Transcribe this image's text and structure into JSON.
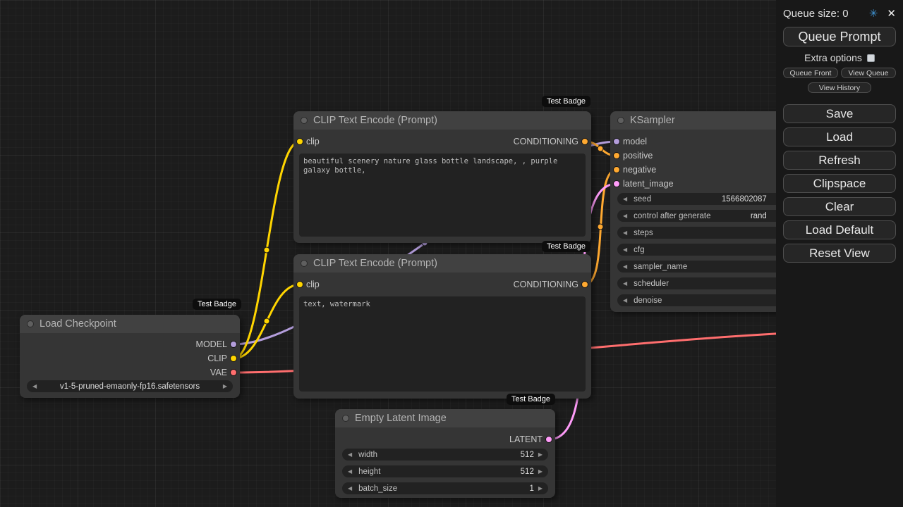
{
  "colors": {
    "model": "#b39ddb",
    "clip": "#ffd500",
    "vae": "#ff6e6e",
    "conditioning": "#ffa931",
    "latent": "#ff9cf9"
  },
  "icons": {
    "arrow_left": "◀",
    "arrow_right": "▶",
    "settings": "✳",
    "close": "✕"
  },
  "badge_label": "Test Badge",
  "menu": {
    "queue_size": "Queue size: 0",
    "queue_prompt": "Queue Prompt",
    "extra_options": "Extra options",
    "queue_front": "Queue Front",
    "view_queue": "View Queue",
    "view_history": "View History",
    "buttons": [
      "Save",
      "Load",
      "Refresh",
      "Clipspace",
      "Clear",
      "Load Default",
      "Reset View"
    ]
  },
  "nodes": {
    "load_checkpoint": {
      "title": "Load Checkpoint",
      "outputs": [
        "MODEL",
        "CLIP",
        "VAE"
      ],
      "ckpt_name": "v1-5-pruned-emaonly-fp16.safetensors"
    },
    "clip_encode_pos": {
      "title": "CLIP Text Encode (Prompt)",
      "input": "clip",
      "output": "CONDITIONING",
      "text": "beautiful scenery nature glass bottle landscape, , purple galaxy bottle,"
    },
    "clip_encode_neg": {
      "title": "CLIP Text Encode (Prompt)",
      "input": "clip",
      "output": "CONDITIONING",
      "text": "text, watermark"
    },
    "ksampler": {
      "title": "KSampler",
      "inputs": [
        "model",
        "positive",
        "negative",
        "latent_image"
      ],
      "widgets": [
        {
          "label": "seed",
          "value": "1566802087"
        },
        {
          "label": "control after generate",
          "value": "rand"
        },
        {
          "label": "steps",
          "value": ""
        },
        {
          "label": "cfg",
          "value": ""
        },
        {
          "label": "sampler_name",
          "value": ""
        },
        {
          "label": "scheduler",
          "value": ""
        },
        {
          "label": "denoise",
          "value": ""
        }
      ]
    },
    "empty_latent": {
      "title": "Empty Latent Image",
      "output": "LATENT",
      "widgets": [
        {
          "label": "width",
          "value": "512"
        },
        {
          "label": "height",
          "value": "512"
        },
        {
          "label": "batch_size",
          "value": "1"
        }
      ]
    }
  }
}
